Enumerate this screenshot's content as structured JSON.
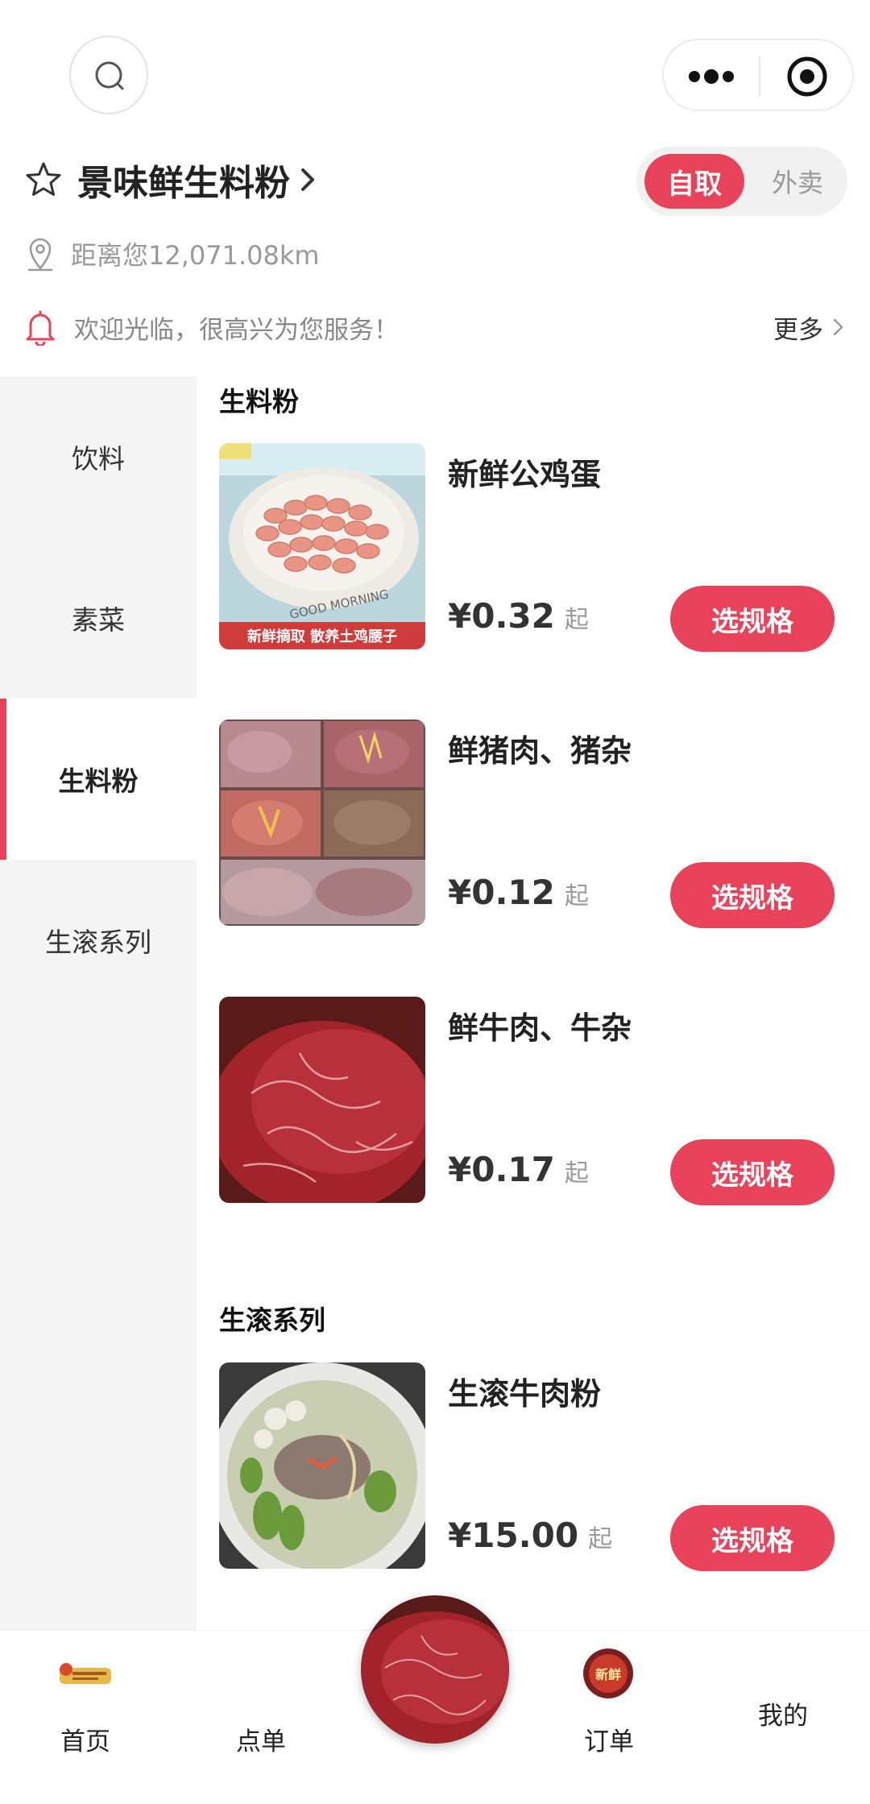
{
  "store": {
    "name": "景味鲜生料粉",
    "distance": "距离您12,071.08km",
    "notice": "欢迎光临，很高兴为您服务！",
    "notice_more": "更多"
  },
  "mode_toggle": {
    "active": "自取",
    "inactive": "外卖"
  },
  "sidebar": {
    "items": [
      {
        "label": "饮料"
      },
      {
        "label": "素菜"
      },
      {
        "label": "生料粉"
      },
      {
        "label": "生滚系列"
      }
    ],
    "active_index": 2
  },
  "sections": [
    {
      "title": "生料粉",
      "products": [
        {
          "name": "新鲜公鸡蛋",
          "price": "¥0.32",
          "price_suffix": "起",
          "button": "选规格",
          "image_caption": "新鲜摘取 散养土鸡腰子",
          "image_text": "GOOD MORNING"
        },
        {
          "name": "鲜猪肉、猪杂",
          "price": "¥0.12",
          "price_suffix": "起",
          "button": "选规格"
        },
        {
          "name": "鲜牛肉、牛杂",
          "price": "¥0.17",
          "price_suffix": "起",
          "button": "选规格"
        }
      ]
    },
    {
      "title": "生滚系列",
      "products": [
        {
          "name": "生滚牛肉粉",
          "price": "¥15.00",
          "price_suffix": "起",
          "button": "选规格"
        }
      ]
    }
  ],
  "tabbar": {
    "home": "首页",
    "order": "点单",
    "orders": "订单",
    "mine": "我的",
    "orders_icon_text": "新鲜"
  },
  "colors": {
    "accent": "#e8435a",
    "sidebar_bg": "#f5f5f5"
  }
}
